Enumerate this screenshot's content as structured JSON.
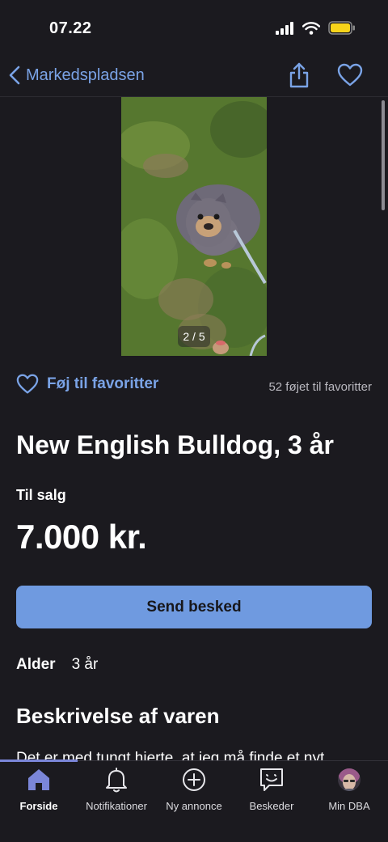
{
  "status": {
    "time": "07.22"
  },
  "nav": {
    "back_label": "Markedspladsen"
  },
  "photo": {
    "counter": "2 / 5"
  },
  "favorites": {
    "add_label": "Føj til favoritter",
    "count_label": "52 føjet til favoritter"
  },
  "listing": {
    "title": "New English Bulldog, 3 år",
    "sale_type": "Til salg",
    "price": "7.000 kr.",
    "send_label": "Send besked",
    "age_label": "Alder",
    "age_value": "3 år",
    "desc_heading": "Beskrivelse af varen",
    "desc_text": "Det er med tungt hjerte, at jeg må finde et nyt"
  },
  "tabs": [
    {
      "label": "Forside",
      "icon": "home-icon"
    },
    {
      "label": "Notifikationer",
      "icon": "bell-icon"
    },
    {
      "label": "Ny annonce",
      "icon": "plus-circle-icon"
    },
    {
      "label": "Beskeder",
      "icon": "message-icon"
    },
    {
      "label": "Min DBA",
      "icon": "avatar"
    }
  ],
  "colors": {
    "accent": "#7aa3e6",
    "button": "#6f9ae0",
    "background": "#1b1a1f",
    "tab_active": "#7b86d8"
  }
}
